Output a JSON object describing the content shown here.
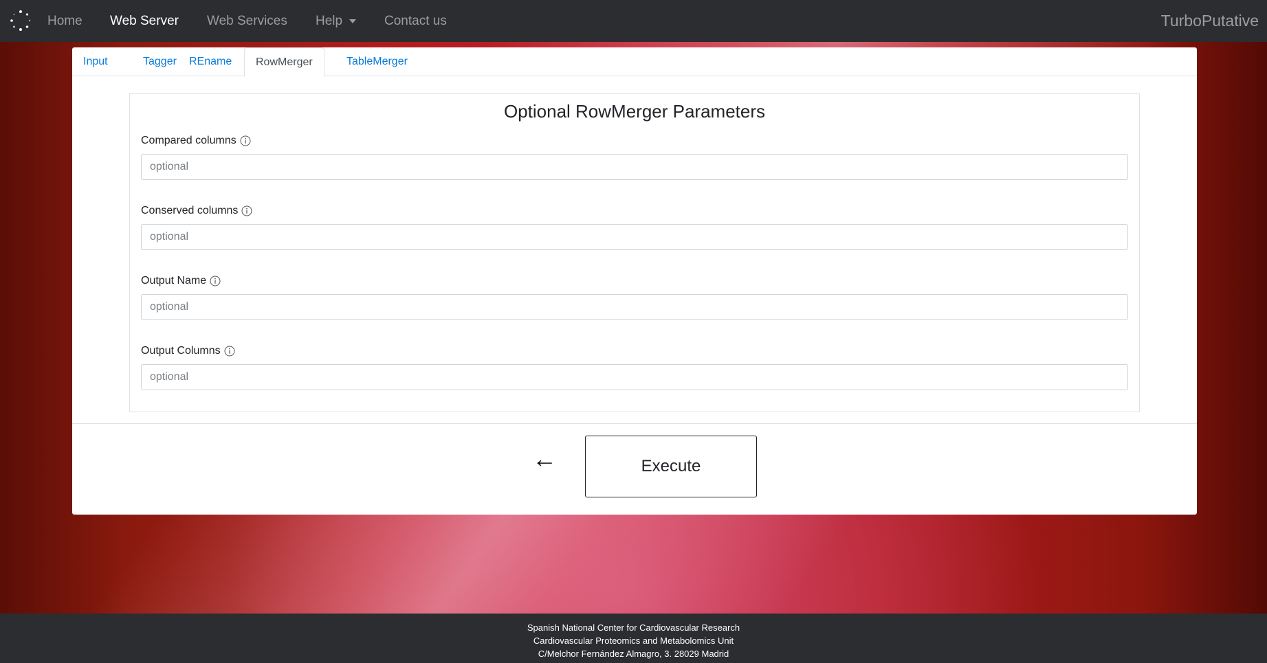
{
  "navbar": {
    "brand_icon": "loading-spinner-icon",
    "items": [
      {
        "label": "Home",
        "active": false
      },
      {
        "label": "Web Server",
        "active": true
      },
      {
        "label": "Web Services",
        "active": false
      },
      {
        "label": "Help",
        "active": false,
        "dropdown": true
      },
      {
        "label": "Contact us",
        "active": false
      }
    ],
    "brand_name": "TurboPutative"
  },
  "tabs": [
    {
      "label": "Input",
      "active": false
    },
    {
      "label": "Tagger",
      "active": false
    },
    {
      "label": "REname",
      "active": false
    },
    {
      "label": "RowMerger",
      "active": true
    },
    {
      "label": "TableMerger",
      "active": false
    }
  ],
  "params": {
    "title": "Optional RowMerger Parameters",
    "fields": [
      {
        "label": "Compared columns",
        "placeholder": "optional",
        "value": "",
        "icon": "info-icon"
      },
      {
        "label": "Conserved columns",
        "placeholder": "optional",
        "value": "",
        "icon": "info-icon"
      },
      {
        "label": "Output Name",
        "placeholder": "optional",
        "value": "",
        "icon": "info-icon"
      },
      {
        "label": "Output Columns",
        "placeholder": "optional",
        "value": "",
        "icon": "info-icon"
      }
    ]
  },
  "actions": {
    "back_label": "←",
    "execute_label": "Execute"
  },
  "footer": {
    "line1": "Spanish National Center for Cardiovascular Research",
    "line2": "Cardiovascular Proteomics and Metabolomics Unit",
    "line3": "C/Melchor Fernández Almagro, 3. 28029 Madrid"
  },
  "colors": {
    "navbar_bg": "#2b2d30",
    "link": "#0a7bd8",
    "background_red": "#b01c1c"
  }
}
